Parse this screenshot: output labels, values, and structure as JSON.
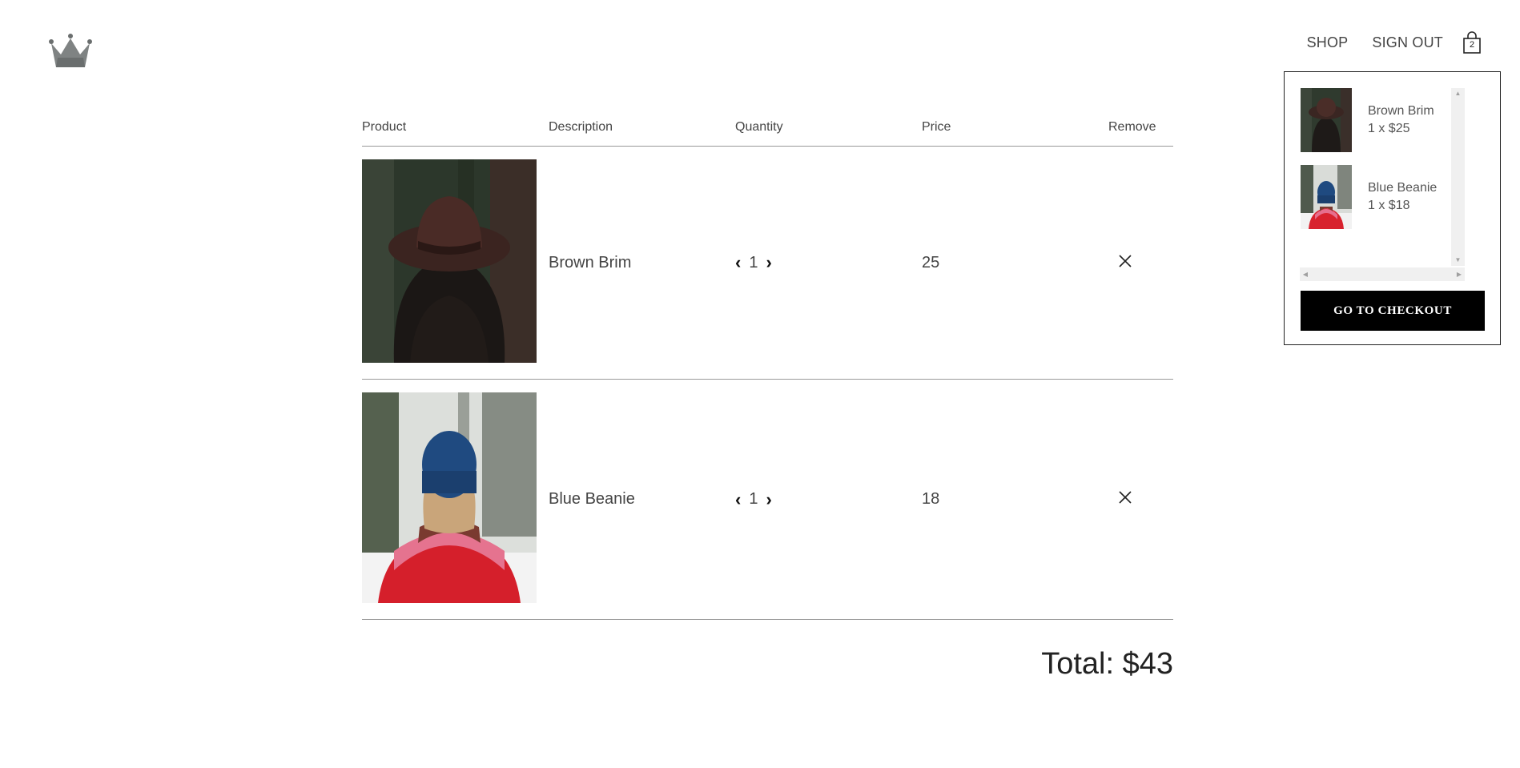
{
  "nav": {
    "shop": "SHOP",
    "sign_out": "SIGN OUT",
    "cart_count": "2"
  },
  "cart": {
    "headers": [
      "Product",
      "Description",
      "Quantity",
      "Price",
      "Remove"
    ],
    "items": [
      {
        "name": "Brown Brim",
        "quantity": "1",
        "price": "25"
      },
      {
        "name": "Blue Beanie",
        "quantity": "1",
        "price": "18"
      }
    ],
    "total": "Total: $43"
  },
  "dropdown": {
    "items": [
      {
        "name": "Brown Brim",
        "qty_price": "1 x $25"
      },
      {
        "name": "Blue Beanie",
        "qty_price": "1 x $18"
      }
    ],
    "checkout_label": "GO TO CHECKOUT"
  },
  "icons": {
    "logo": "crown-icon",
    "cart": "shopping-bag-icon",
    "decrease": "chevron-left-icon",
    "increase": "chevron-right-icon",
    "remove": "close-icon"
  },
  "colors": {
    "logo": "#808282",
    "button": "#000000",
    "text": "#444444"
  }
}
